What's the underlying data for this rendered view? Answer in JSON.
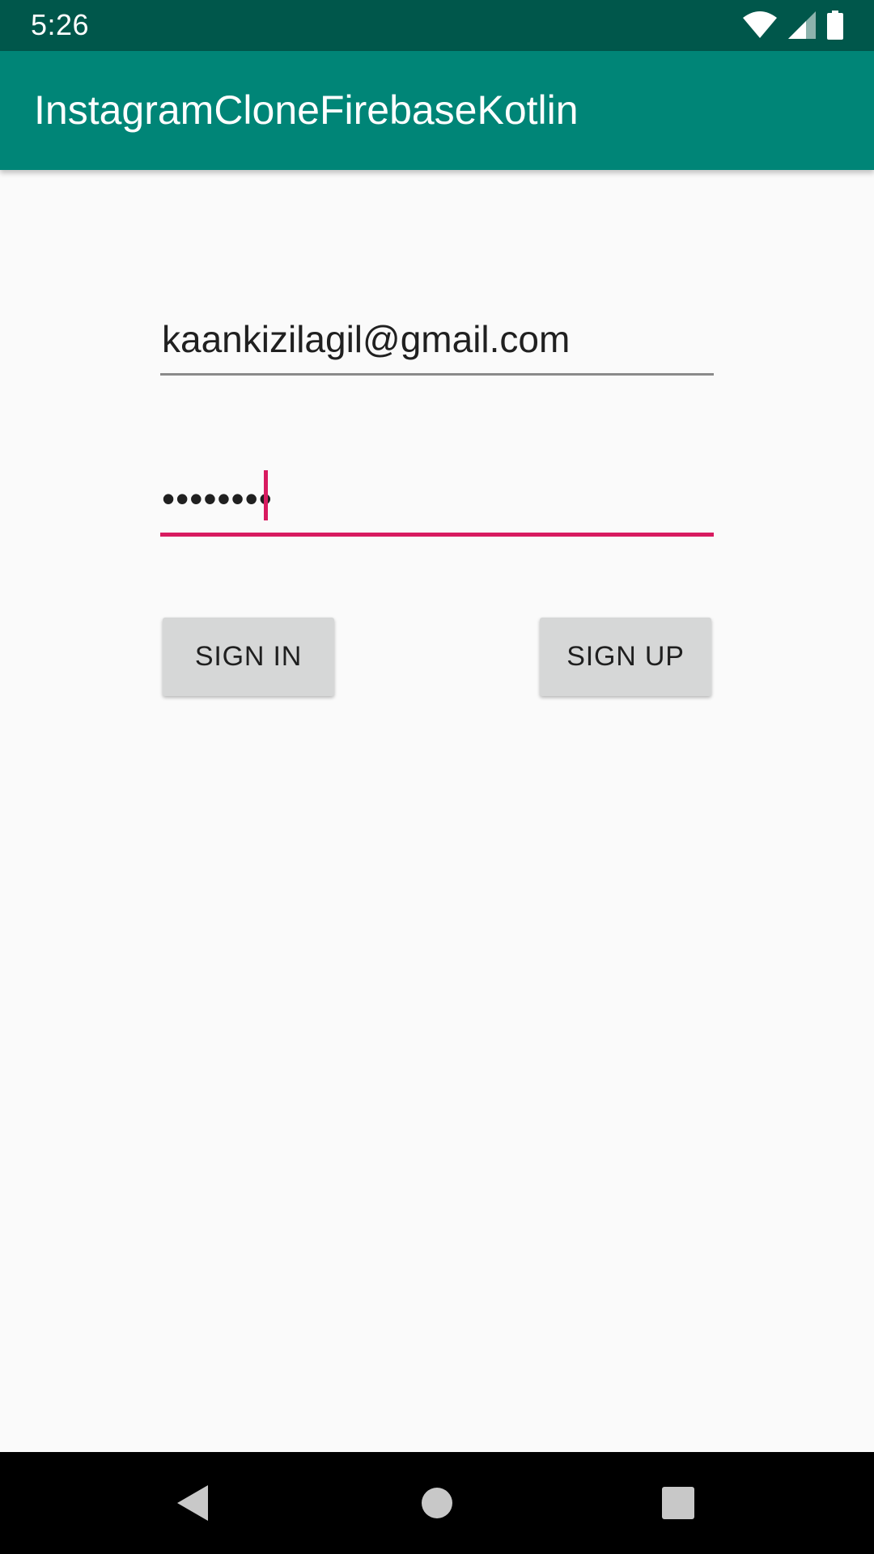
{
  "status_bar": {
    "time": "5:26",
    "icons": [
      "wifi-icon",
      "cell-signal-icon",
      "battery-icon"
    ]
  },
  "app_bar": {
    "title": "InstagramCloneFirebaseKotlin",
    "color": "#008577"
  },
  "form": {
    "email": {
      "value": "kaankizilagil@gmail.com"
    },
    "password": {
      "masked_value": "••••••••",
      "accent_color": "#D81B60"
    },
    "sign_in_label": "SIGN IN",
    "sign_up_label": "SIGN UP"
  },
  "nav_bar": {
    "icons": [
      "back-icon",
      "home-icon",
      "recents-icon"
    ]
  }
}
